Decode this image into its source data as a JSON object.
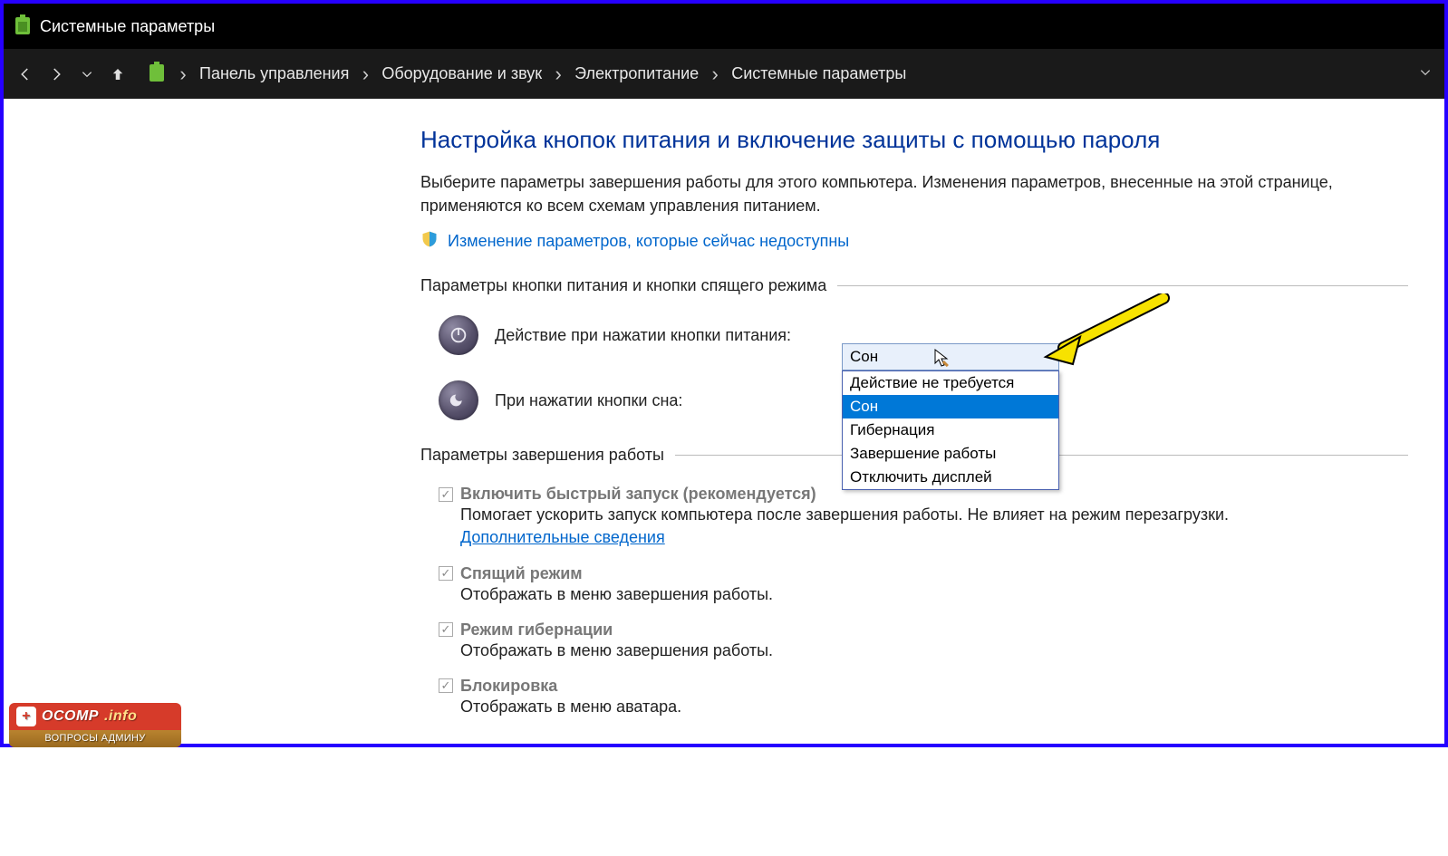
{
  "titlebar": {
    "title": "Системные параметры"
  },
  "breadcrumb": {
    "items": [
      "Панель управления",
      "Оборудование и звук",
      "Электропитание",
      "Системные параметры"
    ]
  },
  "page": {
    "title": "Настройка кнопок питания и включение защиты с помощью пароля",
    "description": "Выберите параметры завершения работы для этого компьютера. Изменения параметров, внесенные на этой странице, применяются ко всем схемам управления питанием.",
    "uac_link": "Изменение параметров, которые сейчас недоступны"
  },
  "section_buttons": {
    "heading": "Параметры кнопки питания и кнопки спящего режима",
    "power_label": "Действие при нажатии кнопки питания:",
    "sleep_label": "При нажатии кнопки сна:"
  },
  "dropdown": {
    "selected": "Сон",
    "options": [
      "Действие не требуется",
      "Сон",
      "Гибернация",
      "Завершение работы",
      "Отключить дисплей"
    ],
    "highlight_index": 1
  },
  "section_shutdown": {
    "heading": "Параметры завершения работы",
    "items": [
      {
        "title": "Включить быстрый запуск (рекомендуется)",
        "desc": "Помогает ускорить запуск компьютера после завершения работы. Не влияет на режим перезагрузки. ",
        "link": "Дополнительные сведения"
      },
      {
        "title": "Спящий режим",
        "desc": "Отображать в меню завершения работы."
      },
      {
        "title": "Режим гибернации",
        "desc": "Отображать в меню завершения работы."
      },
      {
        "title": "Блокировка",
        "desc": "Отображать в меню аватара."
      }
    ]
  },
  "watermark": {
    "brand": "OCOMP",
    "suffix": ".info",
    "sub": "ВОПРОСЫ АДМИНУ"
  }
}
